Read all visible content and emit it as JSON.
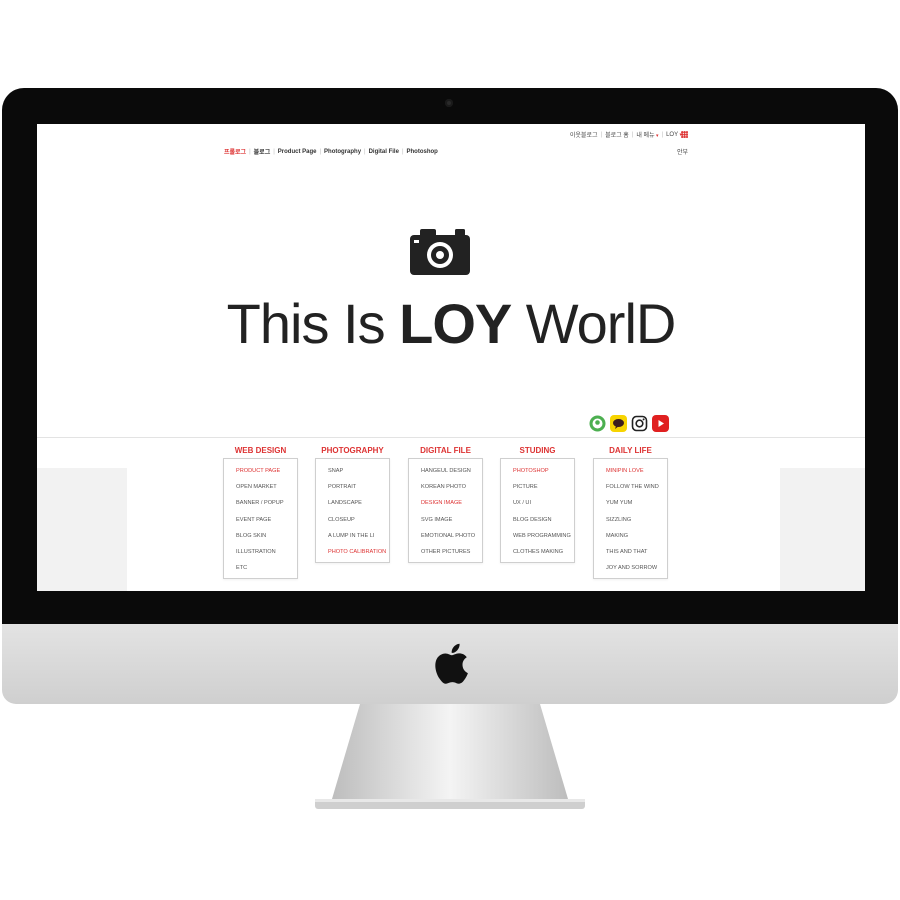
{
  "top_links": [
    {
      "label": "이웃블로그",
      "dropdown": false
    },
    {
      "label": "블로그 홈",
      "dropdown": false
    },
    {
      "label": "내 메뉴",
      "dropdown": true
    },
    {
      "label": "LOY",
      "dropdown": true
    }
  ],
  "nav": {
    "items": [
      {
        "label": "프롤로그",
        "active": true
      },
      {
        "label": "블로그",
        "active": false
      },
      {
        "label": "Product Page",
        "active": false
      },
      {
        "label": "Photography",
        "active": false
      },
      {
        "label": "Digital File",
        "active": false
      },
      {
        "label": "Photoshop",
        "active": false
      }
    ],
    "login": "안부"
  },
  "hero": {
    "title_light_1": "This Is ",
    "title_bold": "LOY",
    "title_light_2": " WorlD"
  },
  "social": [
    {
      "icon": "profile-icon",
      "color": "#4caf50"
    },
    {
      "icon": "chat-icon",
      "color": "#f7d400"
    },
    {
      "icon": "instagram-icon",
      "color": "#222222"
    },
    {
      "icon": "youtube-icon",
      "color": "#e02020"
    }
  ],
  "categories": [
    {
      "title": "WEB DESIGN",
      "items": [
        "PRODUCT PAGE",
        "OPEN MARKET",
        "BANNER / POPUP",
        "EVENT PAGE",
        "BLOG SKIN",
        "ILLUSTRATION",
        "ETC"
      ],
      "highlight": [
        0
      ]
    },
    {
      "title": "PHOTOGRAPHY",
      "items": [
        "SNAP",
        "PORTRAIT",
        "LANDSCAPE",
        "CLOSEUP",
        "A LUMP IN THE LI",
        "PHOTO CALIBRATION"
      ],
      "highlight": [
        5
      ]
    },
    {
      "title": "DIGITAL FILE",
      "items": [
        "HANGEUL DESIGN",
        "KOREAN PHOTO",
        "DESIGN IMAGE",
        "SVG IMAGE",
        "EMOTIONAL PHOTO",
        "OTHER PICTURES"
      ],
      "highlight": [
        2
      ]
    },
    {
      "title": "STUDING",
      "items": [
        "PHOTOSHOP",
        "PICTURE",
        "UX / UI",
        "BLOG DESIGN",
        "WEB PROGRAMMING",
        "CLOTHES MAKING"
      ],
      "highlight": [
        0
      ]
    },
    {
      "title": "DAILY LIFE",
      "items": [
        "MINIPIN LOVE",
        "FOLLOW THE WIND",
        "YUM YUM",
        "SIZZLING",
        "MAKING",
        "THIS AND THAT",
        "JOY AND SORROW"
      ],
      "highlight": [
        0
      ]
    }
  ],
  "colors": {
    "accent": "#dd3333",
    "bezel": "#0a0a0a",
    "chin": "#d8d8d8"
  }
}
